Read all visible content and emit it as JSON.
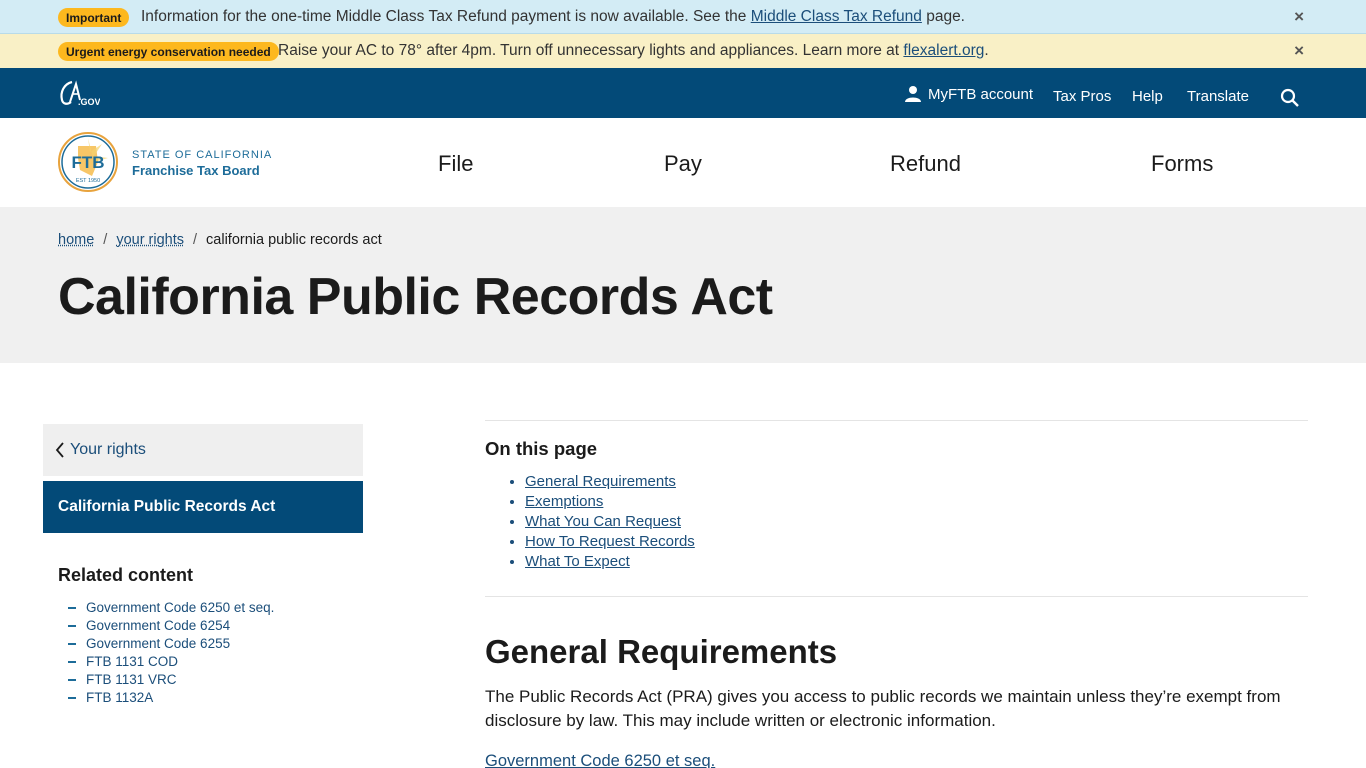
{
  "alerts": [
    {
      "badge": "Important",
      "text_before": "Information for the one-time Middle Class Tax Refund payment is now available. See the",
      "link": "Middle Class Tax Refund",
      "text_after": "page.",
      "close": "×"
    },
    {
      "badge": "Urgent energy conservation needed",
      "text_before": "Raise your AC to 78° after 4pm. Turn off unnecessary lights and appliances. Learn more at",
      "link": "flexalert.org",
      "text_after": ".",
      "close": "×"
    }
  ],
  "utility": {
    "logo_icon": "ca-gov-logo-icon",
    "account": "MyFTB account",
    "account_icon": "user-icon",
    "tax_pros": "Tax Pros",
    "help": "Help",
    "translate": "Translate",
    "search_icon": "search-icon"
  },
  "org": {
    "line1": "STATE OF CALIFORNIA",
    "line2": "Franchise Tax Board",
    "logo_text": "FTB",
    "logo_est": "EST 1950"
  },
  "nav": [
    "File",
    "Pay",
    "Refund",
    "Forms"
  ],
  "breadcrumb": {
    "home": "home",
    "parent": "your rights",
    "current": "california public records act",
    "sep": "/"
  },
  "page_title": "California Public Records Act",
  "sidenav": {
    "back": "Your rights",
    "active": "California Public Records Act"
  },
  "related": {
    "title": "Related content",
    "items": [
      "Government Code 6250 et seq.",
      "Government Code 6254",
      "Government Code 6255",
      "FTB 1131 COD",
      "FTB 1131 VRC",
      "FTB 1132A"
    ]
  },
  "on_this_page": {
    "title": "On this page",
    "items": [
      "General Requirements",
      "Exemptions",
      "What You Can Request",
      "How To Request Records",
      "What To Expect"
    ]
  },
  "section": {
    "title": "General Requirements",
    "body": "The Public Records Act (PRA) gives you access to public records we maintain unless they’re exempt from disclosure by law. This may include written or electronic information.",
    "link": "Government Code 6250 et seq."
  },
  "colors": {
    "brand_blue": "#034a78",
    "link_blue": "#1b4e7a",
    "badge_yellow": "#fdb81e",
    "alert_blue": "#d3ecf5",
    "alert_yellow": "#f9f0c6"
  }
}
